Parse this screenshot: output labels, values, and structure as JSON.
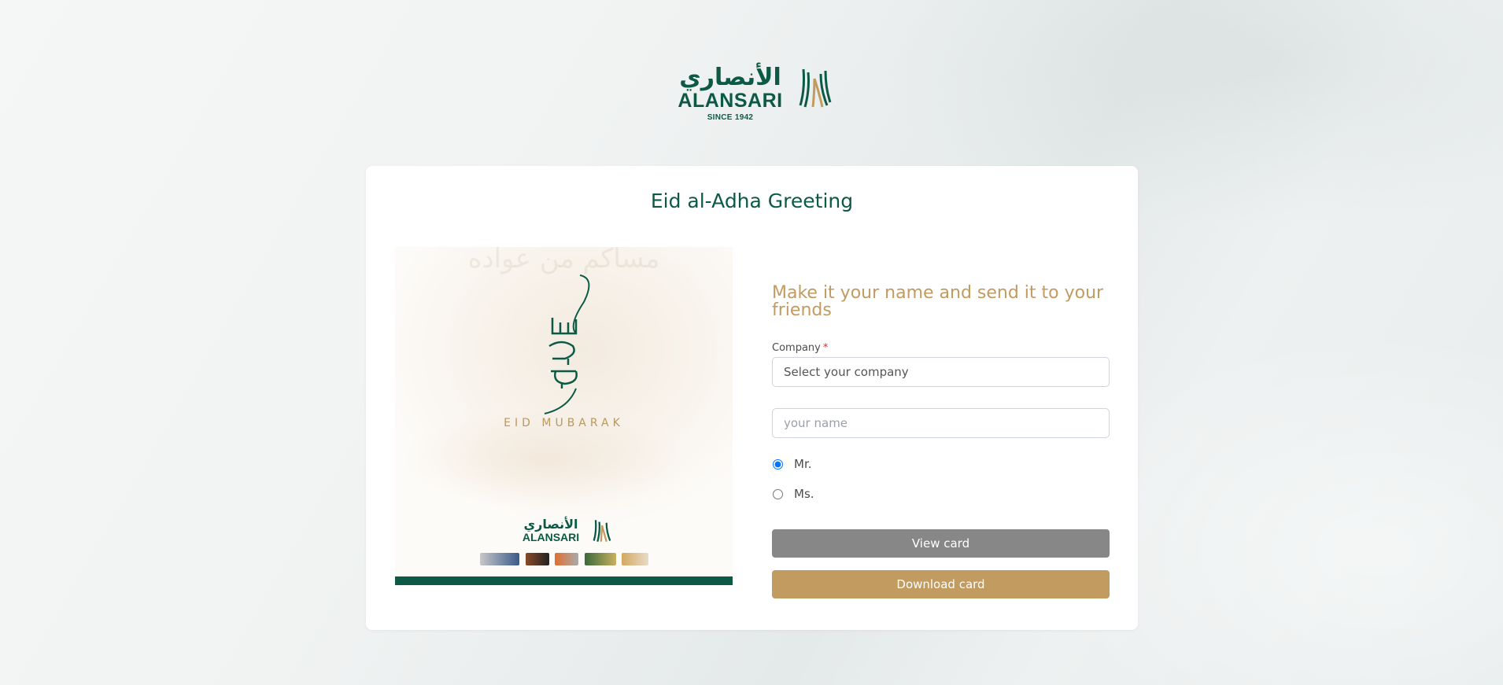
{
  "brand": {
    "arabic_name": "الأنصاري",
    "name": "ALANSARI",
    "since": "SINCE 1942"
  },
  "card": {
    "title": "Eid al-Adha Greeting"
  },
  "greeting_image": {
    "watermark_text": "مساكم من عواده",
    "calligraphy_text": "عساكم من عواده",
    "eid_text": "EID MUBARAK",
    "logo_arabic": "الأنصاري",
    "logo_name": "ALANSARI"
  },
  "form": {
    "heading": "Make it your name and send it to your friends",
    "company_label": "Company",
    "company_required_mark": "*",
    "company_placeholder": "Select your company",
    "name_placeholder": "your name",
    "title_options": [
      {
        "label": "Mr.",
        "checked": true
      },
      {
        "label": "Ms.",
        "checked": false
      }
    ],
    "view_button": "View card",
    "download_button": "Download card"
  },
  "colors": {
    "brand_green": "#0c5a45",
    "brand_gold": "#c19b5f",
    "view_button_gray": "#878787"
  }
}
